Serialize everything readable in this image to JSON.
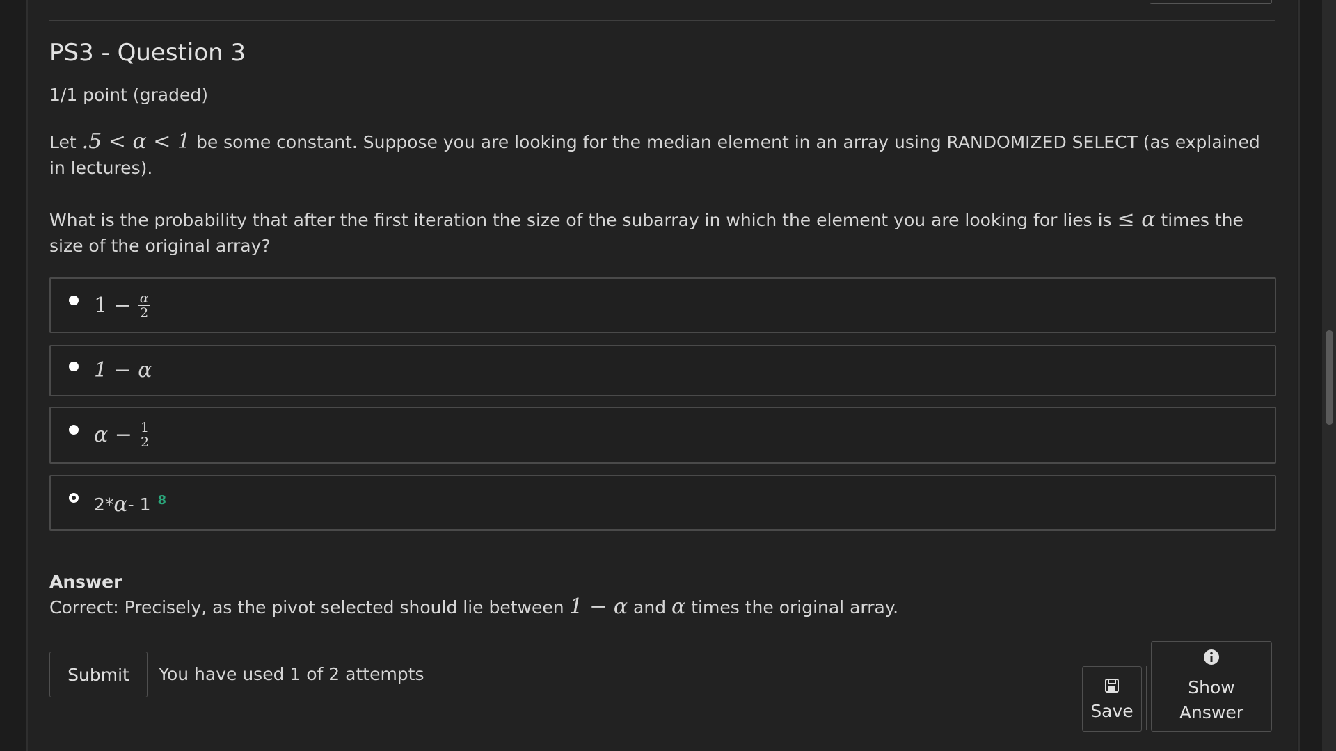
{
  "problem": {
    "title": "PS3 - Question 3",
    "points": "1/1 point (graded)",
    "p1_lead": "Let ",
    "p1_math": ".5 < α < 1",
    "p1_rest": " be some constant. Suppose you are looking for the median element in an array using RANDOMIZED SELECT (as explained in lectures).",
    "p2_lead": "What is the probability that after the first iteration the size of the subarray in which the element you are looking for lies is ",
    "p2_math": "≤ α",
    "p2_rest": " times the size of the original array?"
  },
  "options": [
    {
      "main": "1 −",
      "num": "α",
      "den": "2",
      "selected": false
    },
    {
      "main": "1 − α",
      "selected": false
    },
    {
      "main": "α −",
      "num": "1",
      "den": "2",
      "selected": false
    },
    {
      "text_pre": "2*",
      "alpha": "α",
      "text_post": " - 1",
      "status_glyph": "8",
      "selected": true
    }
  ],
  "answer": {
    "heading": "Answer",
    "prefix": "Correct:  Precisely, as the pivot selected should lie between ",
    "m1": "1 − α",
    "mid": " and ",
    "m2": "α",
    "suffix": " times the original array."
  },
  "actions": {
    "submit_label": "Submit",
    "attempts_text": "You have used 1 of 2 attempts",
    "save_label": "Save",
    "show_answer_line1": "Show",
    "show_answer_line2": "Answer"
  },
  "icons": {
    "save": "save-icon",
    "info": "info-icon"
  },
  "colors": {
    "background": "#222222",
    "text": "#d6d6d6",
    "correct": "#2aa67a"
  }
}
